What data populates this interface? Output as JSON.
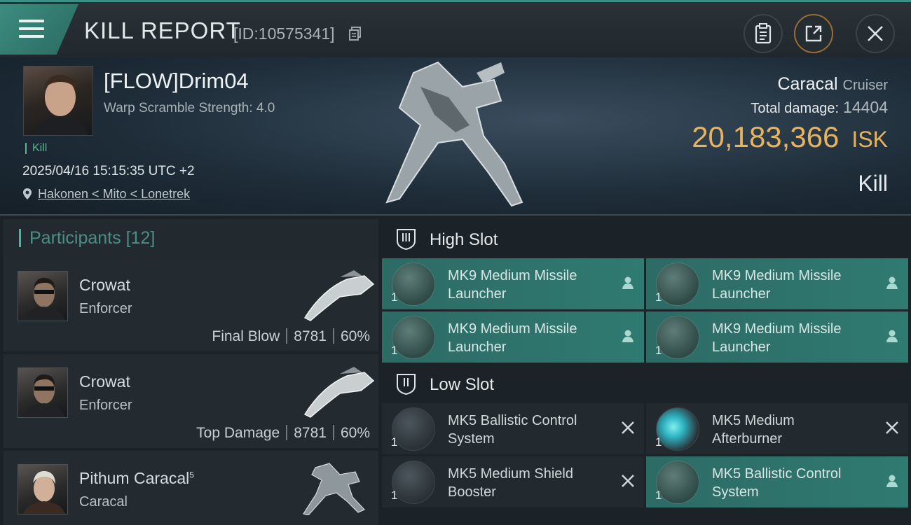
{
  "header": {
    "title": "KILL REPORT",
    "id_text": "[ID:10575341]"
  },
  "victim": {
    "name": "[FLOW]Drim04",
    "warp_scramble": "Warp Scramble Strength: 4.0",
    "tag": "Kill",
    "date": "2025/04/16 15:15:35 UTC +2",
    "location": "Hakonen < Mito < Lonetrek",
    "ship_name": "Caracal",
    "ship_class": "Cruiser",
    "total_damage_label": "Total damage:",
    "total_damage_value": "14404",
    "isk_value": "20,183,366",
    "isk_unit": "ISK",
    "result": "Kill"
  },
  "participants": {
    "label": "Participants",
    "count": "[12]",
    "items": [
      {
        "name": "Crowat",
        "sup": "",
        "ship": "Enforcer",
        "role": "Final Blow",
        "damage": "8781",
        "percent": "60%"
      },
      {
        "name": "Crowat",
        "sup": "",
        "ship": "Enforcer",
        "role": "Top Damage",
        "damage": "8781",
        "percent": "60%"
      },
      {
        "name": "Pithum Caracal",
        "sup": "5",
        "ship": "Caracal",
        "role": "",
        "damage": "",
        "percent": ""
      }
    ]
  },
  "fitting": {
    "high_slot": {
      "label": "High Slot",
      "modules": [
        {
          "name": "MK9 Medium Missile Launcher",
          "qty": "1",
          "state": "pilot-icon"
        },
        {
          "name": "MK9 Medium Missile Launcher",
          "qty": "1",
          "state": "pilot-icon"
        },
        {
          "name": "MK9 Medium Missile Launcher",
          "qty": "1",
          "state": "pilot-icon"
        },
        {
          "name": "MK9 Medium Missile Launcher",
          "qty": "1",
          "state": "pilot-icon"
        }
      ]
    },
    "low_slot": {
      "label": "Low Slot",
      "modules": [
        {
          "name": "MK5 Ballistic Control System",
          "qty": "1",
          "state": "destroyed-icon"
        },
        {
          "name": "MK5 Medium Afterburner",
          "qty": "1",
          "state": "destroyed-icon"
        },
        {
          "name": "MK5 Medium Shield Booster",
          "qty": "1",
          "state": "destroyed-icon"
        },
        {
          "name": "MK5 Ballistic Control System",
          "qty": "1",
          "state": "pilot-icon"
        }
      ]
    }
  },
  "colors": {
    "accent": "#3c8f85",
    "isk": "#e9b35d",
    "module_active": "#2f7a71",
    "kill_tag": "#5fb28c"
  }
}
